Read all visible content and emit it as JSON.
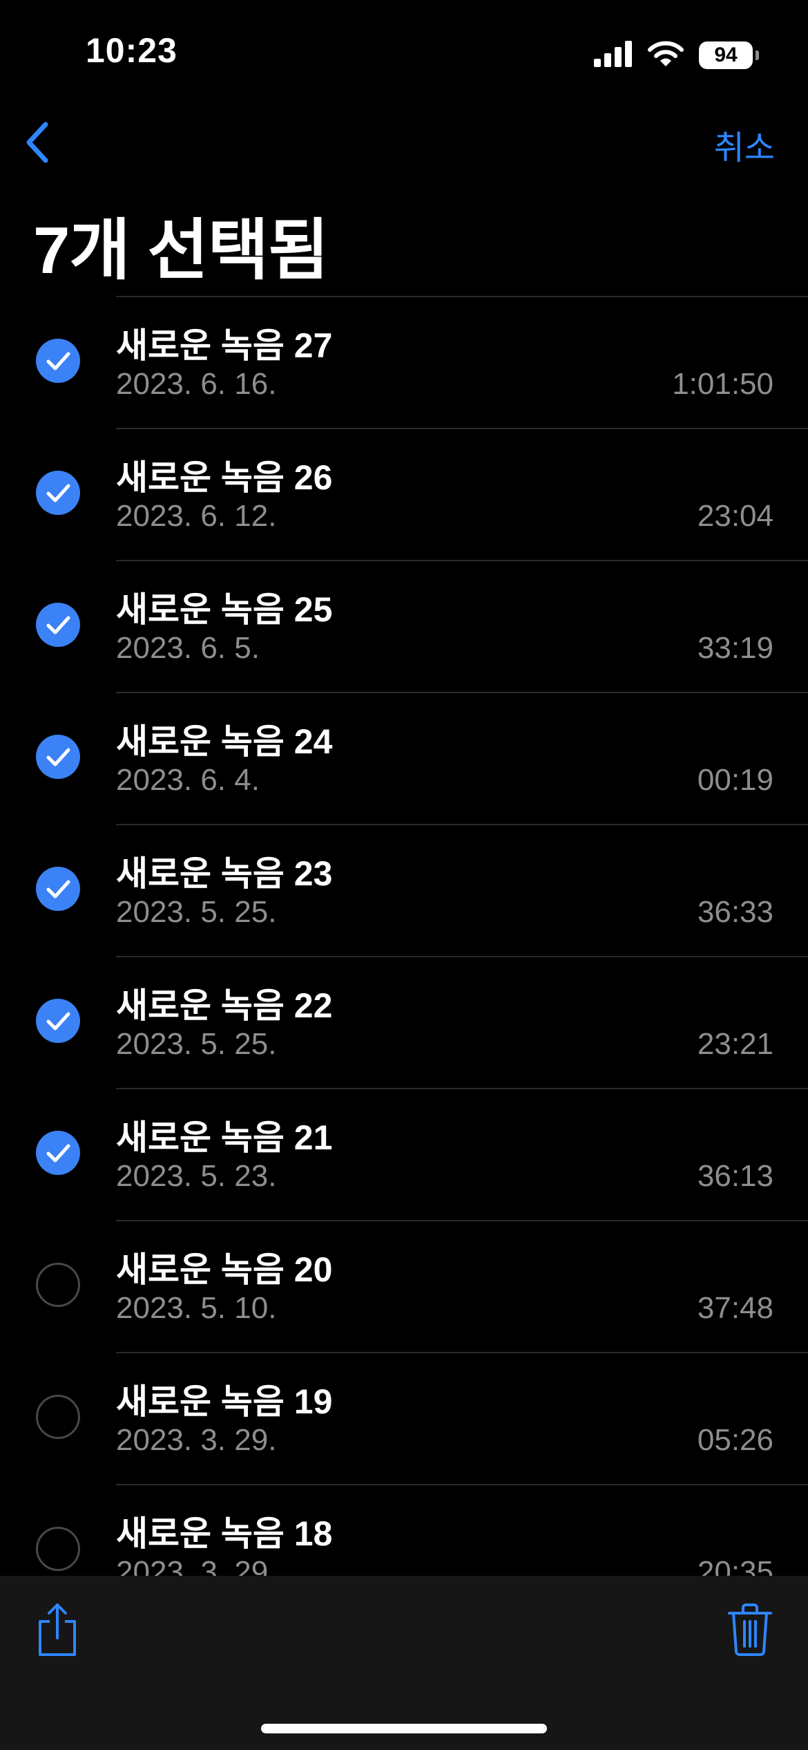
{
  "status_bar": {
    "time": "10:23",
    "battery": "94"
  },
  "nav": {
    "cancel_label": "취소",
    "title": "7개 선택됨"
  },
  "recordings": [
    {
      "title": "새로운 녹음 27",
      "date": "2023. 6. 16.",
      "duration": "1:01:50",
      "selected": true
    },
    {
      "title": "새로운 녹음 26",
      "date": "2023. 6. 12.",
      "duration": "23:04",
      "selected": true
    },
    {
      "title": "새로운 녹음 25",
      "date": "2023. 6. 5.",
      "duration": "33:19",
      "selected": true
    },
    {
      "title": "새로운 녹음 24",
      "date": "2023. 6. 4.",
      "duration": "00:19",
      "selected": true
    },
    {
      "title": "새로운 녹음 23",
      "date": "2023. 5. 25.",
      "duration": "36:33",
      "selected": true
    },
    {
      "title": "새로운 녹음 22",
      "date": "2023. 5. 25.",
      "duration": "23:21",
      "selected": true
    },
    {
      "title": "새로운 녹음 21",
      "date": "2023. 5. 23.",
      "duration": "36:13",
      "selected": true
    },
    {
      "title": "새로운 녹음 20",
      "date": "2023. 5. 10.",
      "duration": "37:48",
      "selected": false
    },
    {
      "title": "새로운 녹음 19",
      "date": "2023. 3. 29.",
      "duration": "05:26",
      "selected": false
    },
    {
      "title": "새로운 녹음 18",
      "date": "2023. 3. 29.",
      "duration": "20:35",
      "selected": false
    }
  ],
  "colors": {
    "accent": "#2f86ff",
    "checkbox": "#3b82f6",
    "background": "#000000"
  },
  "icons": {
    "back": "chevron-left-icon",
    "share": "share-icon",
    "trash": "trash-icon"
  }
}
